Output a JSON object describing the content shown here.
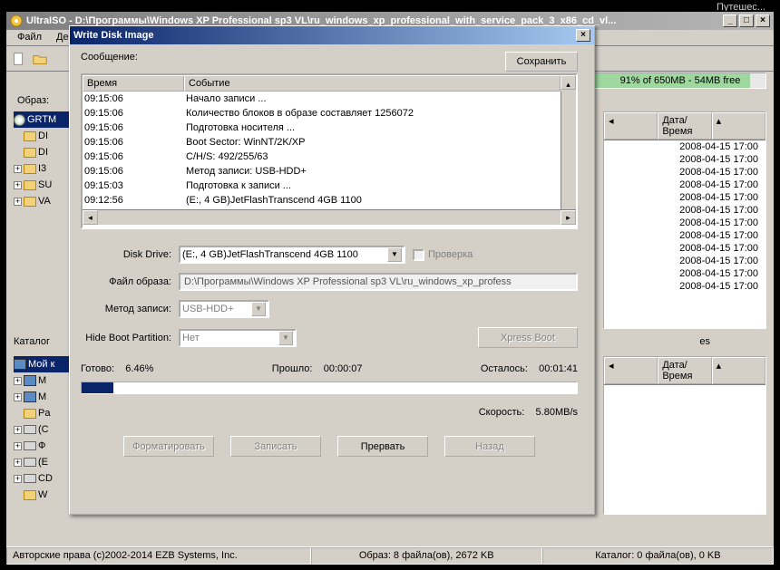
{
  "taskbar_hint": "Путешес...",
  "main": {
    "title": "UltraISO - D:\\Программы\\Windows XP Professional sp3 VL\\ru_windows_xp_professional_with_service_pack_3_x86_cd_vl...",
    "menu": {
      "file": "Файл",
      "deystviya_cut": "Де"
    },
    "win_btns": {
      "min": "_",
      "max": "□",
      "close": "×"
    },
    "space_text": "91% of 650MB - 54MB free",
    "obraz_label": "Образ:",
    "tree": {
      "root": "GRTM",
      "items": [
        "DI",
        "DI",
        "I3",
        "SU",
        "VA"
      ]
    },
    "right_headers": {
      "date": "Дата/Время"
    },
    "right_dates": [
      "2008-04-15 17:00",
      "2008-04-15 17:00",
      "2008-04-15 17:00",
      "2008-04-15 17:00",
      "2008-04-15 17:00",
      "2008-04-15 17:00",
      "2008-04-15 17:00",
      "2008-04-15 17:00",
      "2008-04-15 17:00",
      "2008-04-15 17:00",
      "2008-04-15 17:00",
      "2008-04-15 17:00"
    ],
    "katalog_label": "Каталог",
    "local_root": "Мой к",
    "local_items": [
      "M",
      "M",
      "Pa",
      "(C",
      "Ф",
      "(E",
      "CD",
      "W"
    ],
    "es_label": "es",
    "local_right_header": "Дата/Время",
    "status": {
      "copyright": "Авторские права (c)2002-2014 EZB Systems, Inc.",
      "obraz": "Образ: 8 файла(ов), 2672 KB",
      "katalog": "Каталог: 0 файла(ов), 0 KB"
    }
  },
  "dialog": {
    "title": "Write Disk Image",
    "close": "×",
    "soobshenie": "Сообщение:",
    "save_btn": "Сохранить",
    "log_headers": {
      "time": "Время",
      "event": "Событие"
    },
    "log_rows": [
      {
        "t": "09:12:56",
        "e": "(E:, 4 GB)JetFlashTranscend 4GB   1100"
      },
      {
        "t": "09:15:03",
        "e": "Подготовка к записи ..."
      },
      {
        "t": "09:15:06",
        "e": "Метод записи: USB-HDD+"
      },
      {
        "t": "09:15:06",
        "e": "C/H/S: 492/255/63"
      },
      {
        "t": "09:15:06",
        "e": "Boot Sector: WinNT/2K/XP"
      },
      {
        "t": "09:15:06",
        "e": "Подготовка носителя ..."
      },
      {
        "t": "09:15:06",
        "e": "Количество блоков в образе составляет 1256072"
      },
      {
        "t": "09:15:06",
        "e": "Начало записи ..."
      }
    ],
    "labels": {
      "disk_drive": "Disk Drive:",
      "file_obraz": "Файл образа:",
      "method": "Метод записи:",
      "hide_boot": "Hide Boot Partition:",
      "proverka": "Проверка",
      "gotovo": "Готово:",
      "proshlo": "Прошло:",
      "ostalos": "Осталось:",
      "skorost": "Скорость:"
    },
    "values": {
      "disk_drive": "(E:, 4 GB)JetFlashTranscend 4GB   1100",
      "file_obraz": "D:\\Программы\\Windows XP Professional sp3 VL\\ru_windows_xp_profess",
      "method": "USB-HDD+",
      "hide_boot": "Нет",
      "done_pct": "6.46%",
      "elapsed": "00:00:07",
      "remaining": "00:01:41",
      "speed": "5.80MB/s"
    },
    "buttons": {
      "xpress": "Xpress Boot",
      "format": "Форматировать",
      "write": "Записать",
      "abort": "Прервать",
      "back": "Назад"
    }
  }
}
